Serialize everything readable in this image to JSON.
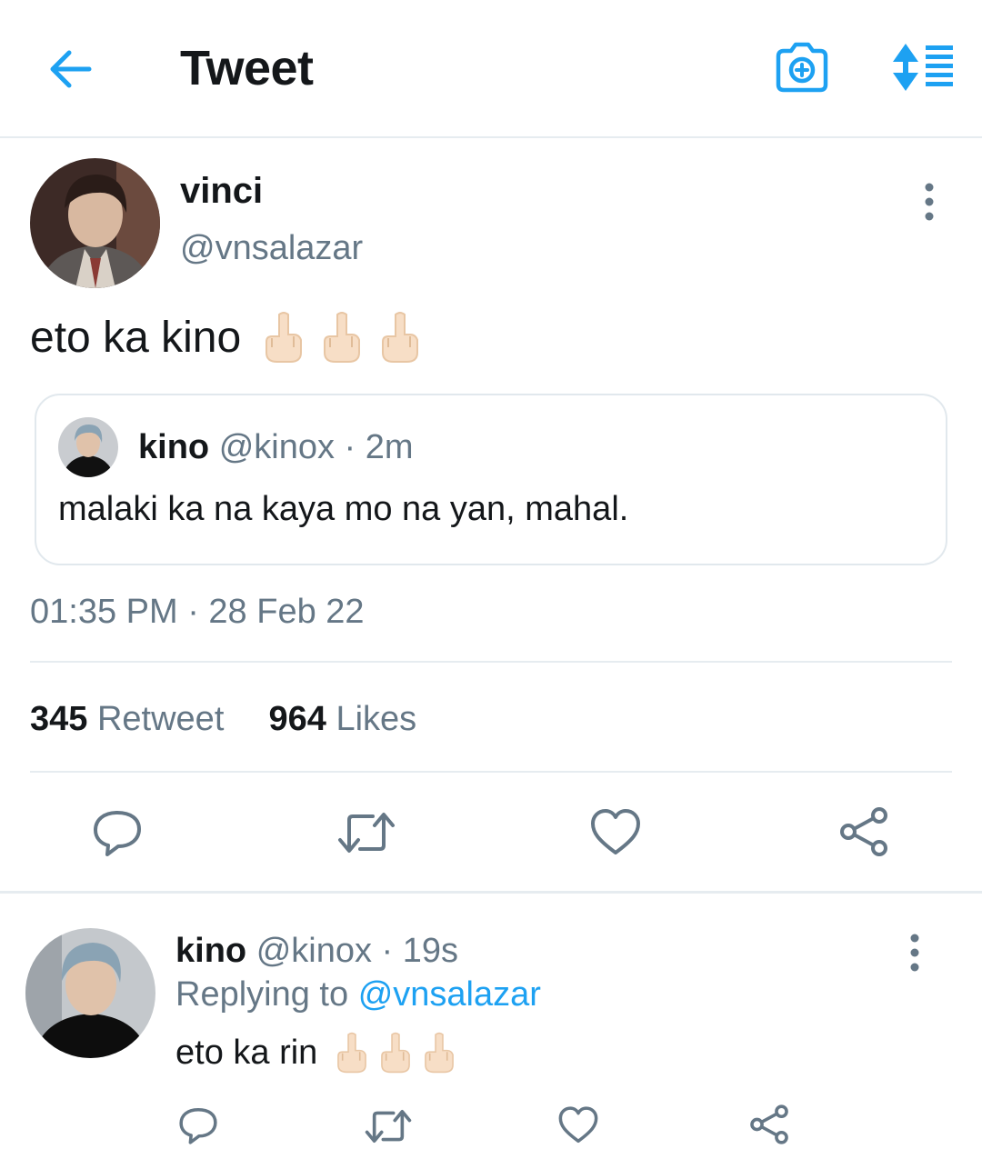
{
  "header": {
    "title": "Tweet",
    "back_icon": "arrow-left-icon",
    "camera_icon": "camera-add-icon",
    "sort_icon": "sort-list-icon",
    "accent_color": "#1da1f2"
  },
  "tweet": {
    "author_name": "vinci",
    "author_handle": "@vnsalazar",
    "text": "eto ka kino",
    "emoji_icon": "middle-finger-emoji-icon",
    "emoji_count": 3,
    "quote": {
      "author_name": "kino",
      "author_handle": "@kinox",
      "separator": "·",
      "time": "2m",
      "text": "malaki ka na kaya mo na yan, mahal."
    },
    "timestamp": "01:35 PM · 28 Feb 22",
    "retweets_count": "345",
    "retweets_label": "Retweet",
    "likes_count": "964",
    "likes_label": "Likes",
    "actions": [
      "reply-icon",
      "retweet-icon",
      "like-icon",
      "share-icon"
    ]
  },
  "reply": {
    "author_name": "kino",
    "author_handle": "@kinox",
    "separator": "·",
    "time": "19s",
    "replying_label": "Replying to",
    "replying_handle": "@vnsalazar",
    "text": "eto ka rin",
    "emoji_icon": "middle-finger-emoji-icon",
    "emoji_count": 3
  }
}
